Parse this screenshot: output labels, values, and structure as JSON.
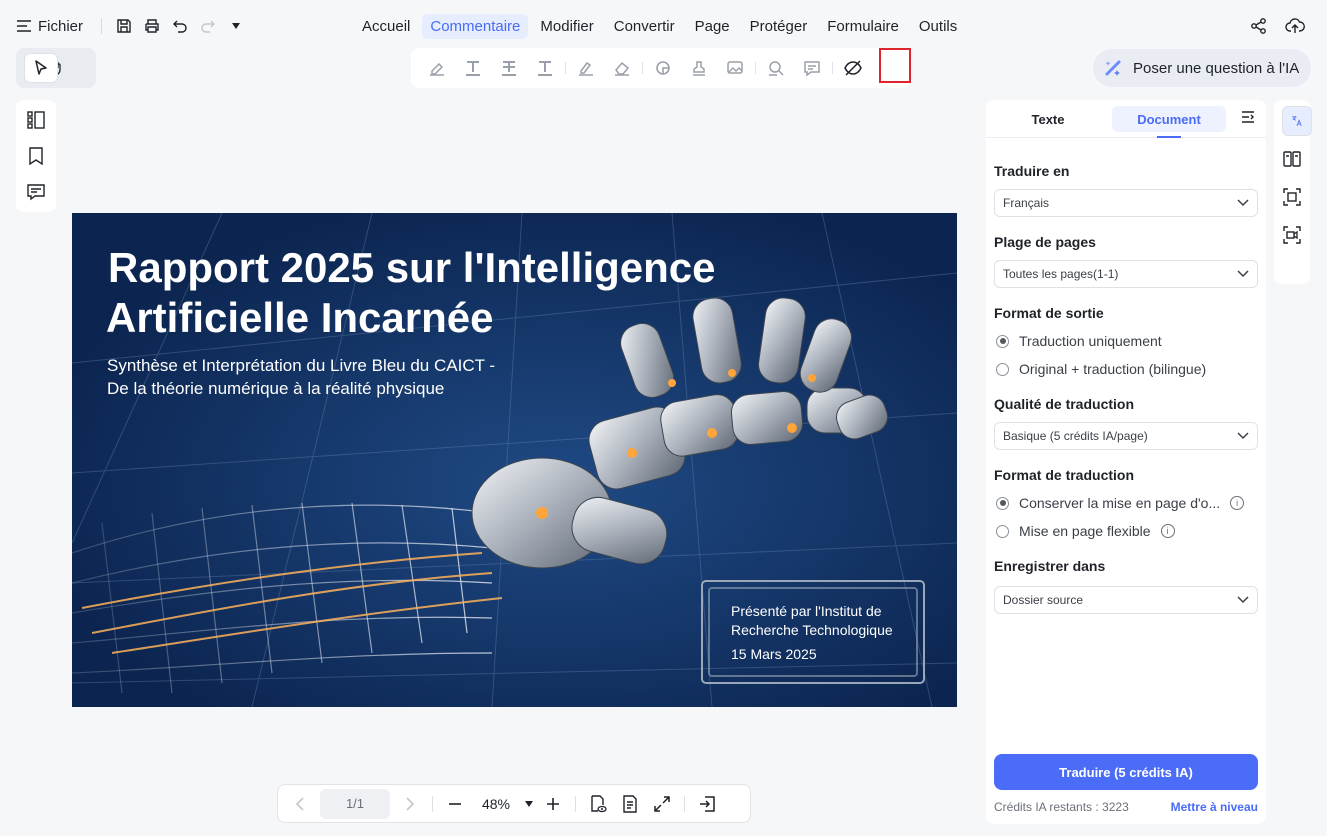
{
  "topbar": {
    "file_label": "Fichier",
    "menu": [
      "Accueil",
      "Commentaire",
      "Modifier",
      "Convertir",
      "Page",
      "Protéger",
      "Formulaire",
      "Outils"
    ],
    "active_menu": "Commentaire"
  },
  "ask_ai": {
    "label": "Poser une question à l'IA"
  },
  "document": {
    "title_line1": "Rapport 2025 sur l'Intelligence",
    "title_line2": "Artificielle Incarnée",
    "subtitle_line1": "Synthèse et Interprétation du Livre Bleu du CAICT -",
    "subtitle_line2": "De la théorie numérique à la réalité physique",
    "presenter_line1": "Présenté par l'Institut de",
    "presenter_line2": "Recherche Technologique",
    "date": "15 Mars 2025"
  },
  "panel": {
    "tab_text": "Texte",
    "tab_document": "Document",
    "translate_to_label": "Traduire en",
    "translate_to_value": "Français",
    "page_range_label": "Plage de pages",
    "page_range_value": "Toutes les pages(1-1)",
    "output_format_label": "Format de sortie",
    "output_opt1": "Traduction uniquement",
    "output_opt2": "Original + traduction (bilingue)",
    "quality_label": "Qualité de traduction",
    "quality_value": "Basique (5 crédits IA/page)",
    "trans_format_label": "Format de traduction",
    "trans_opt1": "Conserver la mise en page d'o...",
    "trans_opt2": "Mise en page flexible",
    "save_label": "Enregistrer dans",
    "save_value": "Dossier source",
    "translate_button": "Traduire (5 crédits IA)",
    "credits": "Crédits IA restants : 3223",
    "upgrade": "Mettre à niveau"
  },
  "bottombar": {
    "page_indicator": "1/1",
    "zoom": "48%"
  },
  "colors": {
    "accent": "#4a6cf7",
    "highlight_box": "#e0242b",
    "doc_bg": "#0e2a55"
  }
}
